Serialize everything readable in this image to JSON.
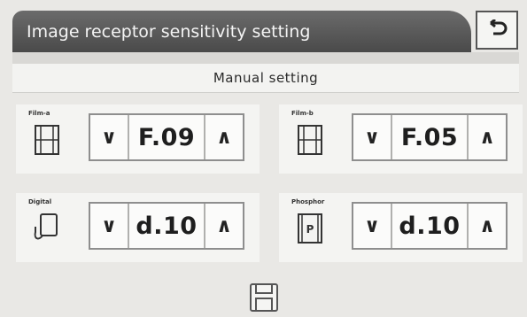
{
  "header": {
    "title": "Image receptor sensitivity setting",
    "back_icon": "back-arrow-icon"
  },
  "mode": {
    "label": "Manual setting"
  },
  "receptors": [
    {
      "label": "Film-a",
      "icon": "film-icon",
      "value": "F.09",
      "down": "∨",
      "up": "∧"
    },
    {
      "label": "Film-b",
      "icon": "film-icon",
      "value": "F.05",
      "down": "∨",
      "up": "∧"
    },
    {
      "label": "Digital",
      "icon": "digital-sensor-icon",
      "value": "d.10",
      "down": "∨",
      "up": "∧"
    },
    {
      "label": "Phosphor",
      "icon": "phosphor-plate-icon",
      "value": "d.10",
      "down": "∨",
      "up": "∧"
    }
  ],
  "footer": {
    "save_icon": "save-icon"
  },
  "colors": {
    "title_bg": "#5a5a5a",
    "page_bg": "#e9e8e5"
  }
}
